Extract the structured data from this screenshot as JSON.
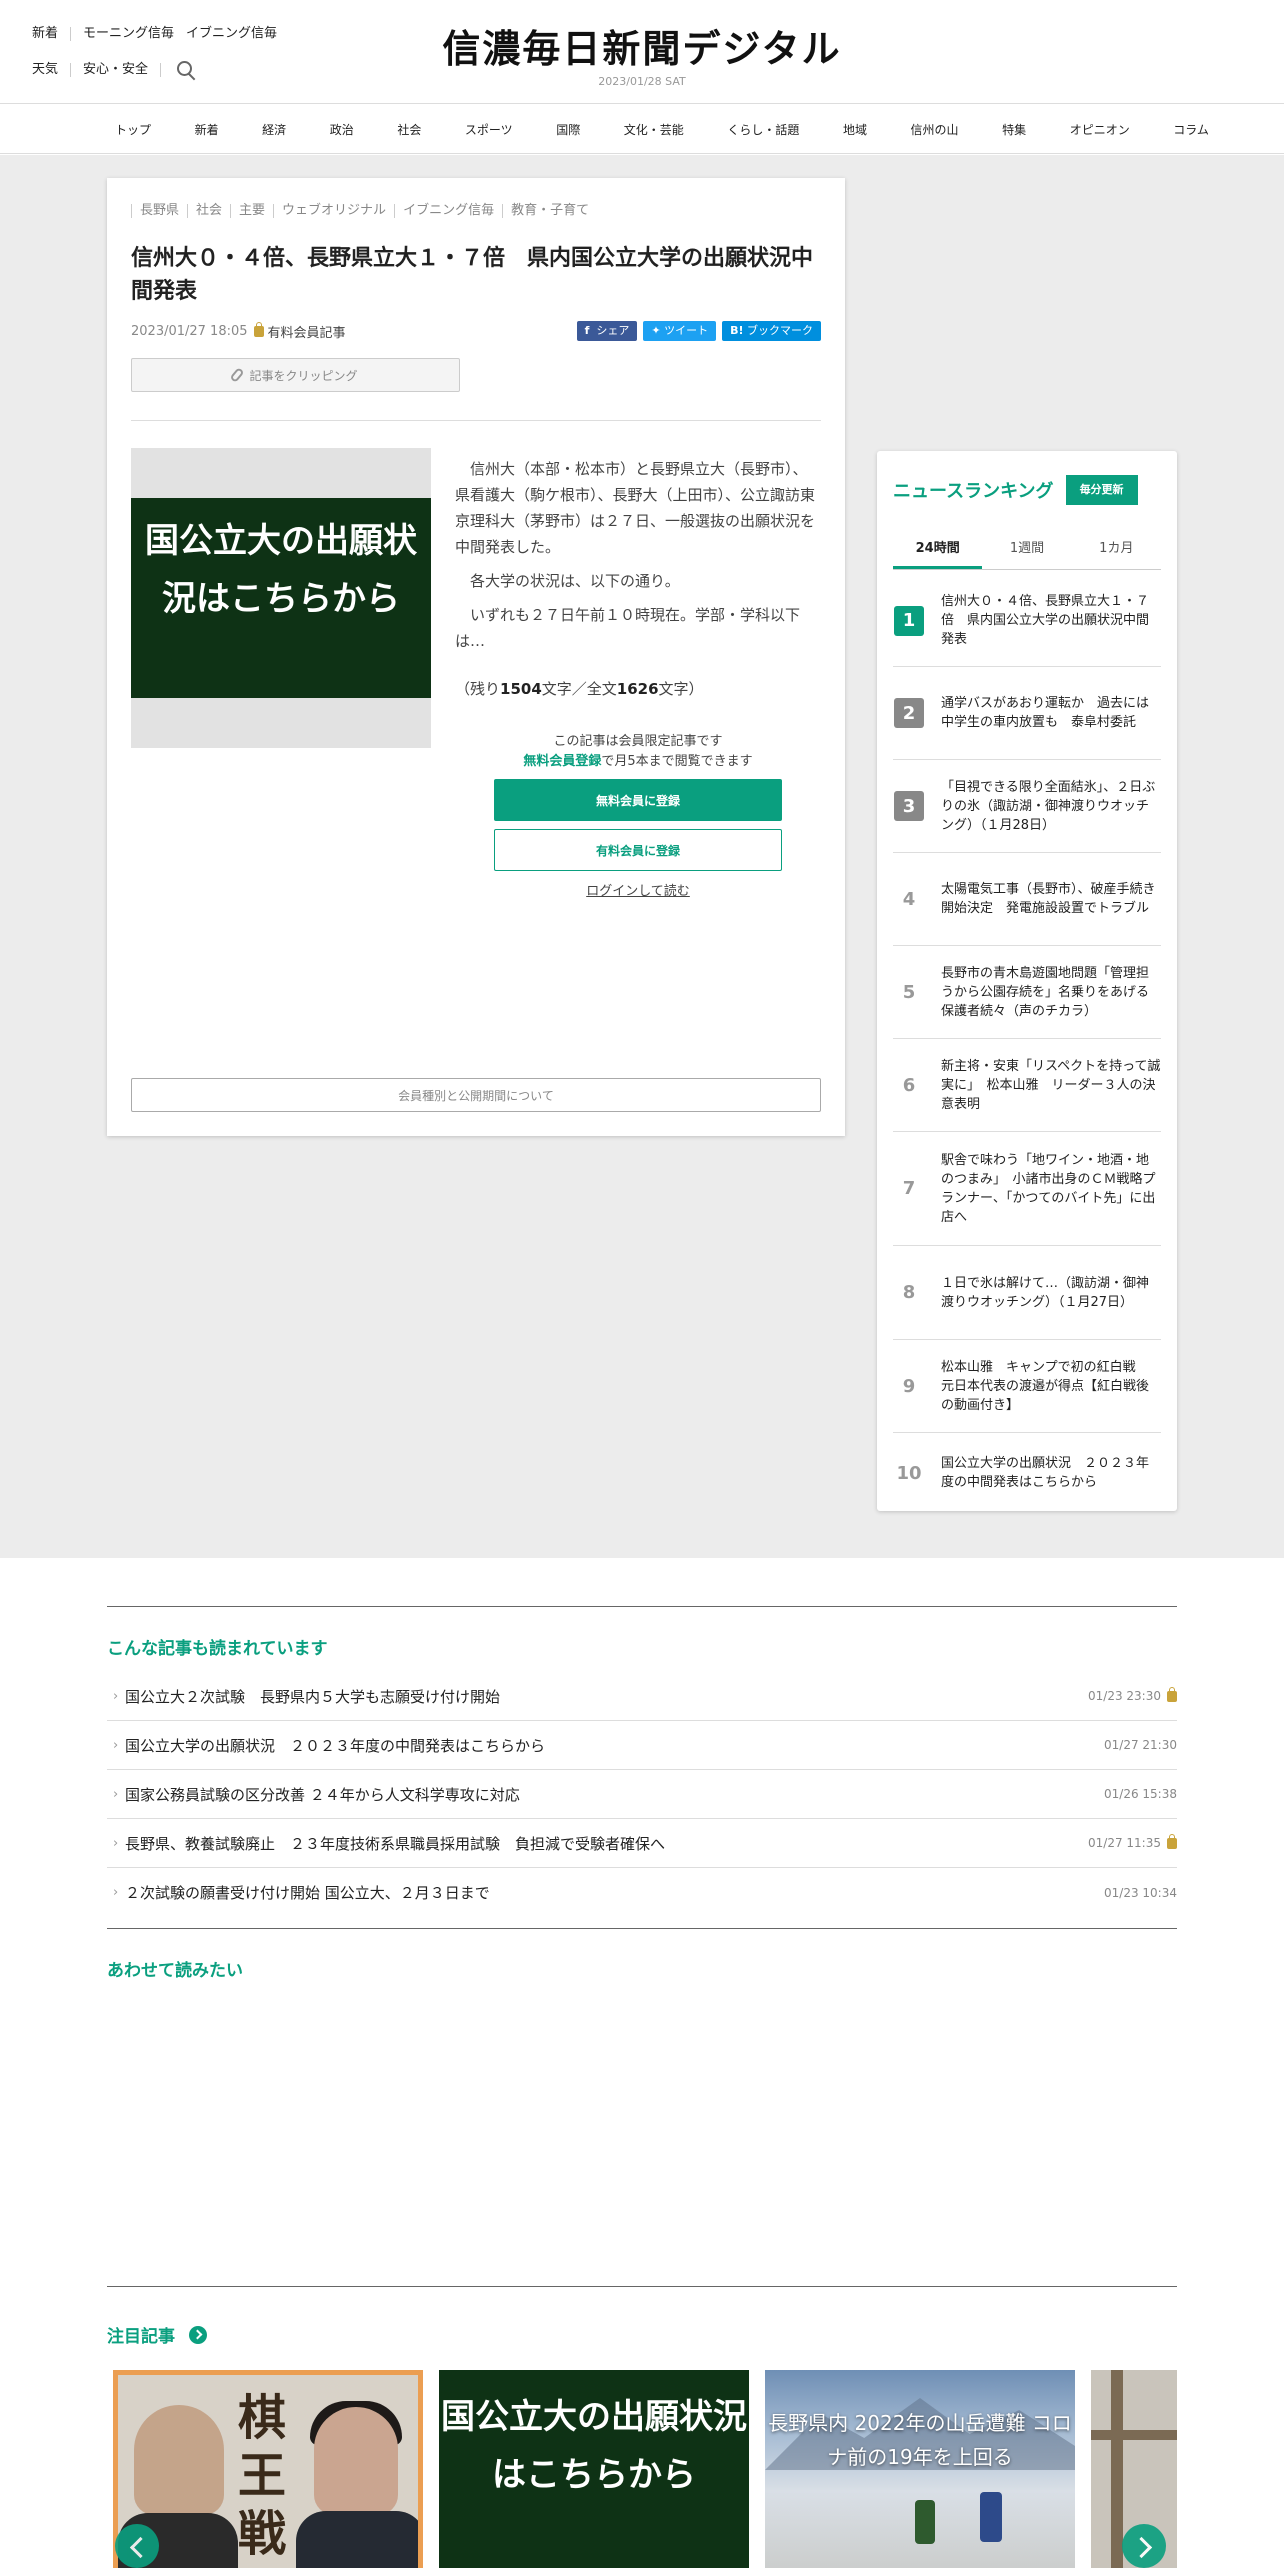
{
  "header": {
    "links_row1": [
      "新着",
      "モーニング信毎",
      "イブニング信毎"
    ],
    "links_row2": [
      "天気",
      "安心・安全"
    ],
    "logo": "信濃毎日新聞デジタル",
    "date": "2023/01/28 SAT"
  },
  "nav": [
    "トップ",
    "新着",
    "経済",
    "政治",
    "社会",
    "スポーツ",
    "国際",
    "文化・芸能",
    "くらし・話題",
    "地域",
    "信州の山",
    "特集",
    "オピニオン",
    "コラム"
  ],
  "article": {
    "tags": [
      "長野県",
      "社会",
      "主要",
      "ウェブオリジナル",
      "イブニング信毎",
      "教育・子育て"
    ],
    "headline": "信州大０・４倍、長野県立大１・７倍　県内国公立大学の出願状況中間発表",
    "datetime": "2023/01/27 18:05",
    "paid_label": "有料会員記事",
    "share_fb": "シェア",
    "share_tw": "ツイート",
    "share_hb": "ブックマーク",
    "clip_label": "記事をクリッピング",
    "thumb_text": "国公立大の出願状況はこちらから",
    "paragraphs": [
      "信州大（本部・松本市）と長野県立大（長野市）、県看護大（駒ケ根市）、長野大（上田市）、公立諏訪東京理科大（茅野市）は２７日、一般選抜の出願状況を中間発表した。",
      "各大学の状況は、以下の通り。",
      "いずれも２７日午前１０時現在。学部・学科以下は…"
    ],
    "remain_pre": "（残り",
    "remain_chars": "1504",
    "remain_mid": "文字／全文",
    "total_chars": "1626",
    "remain_post": "文字）",
    "members_line1": "この記事は会員限定記事です",
    "members_link": "無料会員登録",
    "members_line2": "で月5本まで閲覧できます",
    "btn_free": "無料会員に登録",
    "btn_paid": "有料会員に登録",
    "login": "ログインして読む",
    "plans": "会員種別と公開期間について"
  },
  "ranking": {
    "title": "ニュースランキング",
    "badge": "毎分更新",
    "tabs": [
      "24時間",
      "1週間",
      "1カ月"
    ],
    "items": [
      {
        "num": "1",
        "text": "信州大０・４倍、長野県立大１・７倍　県内国公立大学の出願状況中間発表"
      },
      {
        "num": "2",
        "text": "通学バスがあおり運転か　過去には中学生の車内放置も　泰阜村委託"
      },
      {
        "num": "3",
        "text": "「目視できる限り全面結氷」、２日ぶりの氷（諏訪湖・御神渡りウオッチング）（１月28日）"
      },
      {
        "num": "4",
        "text": "太陽電気工事（長野市）、破産手続き開始決定　発電施設設置でトラブル"
      },
      {
        "num": "5",
        "text": "長野市の青木島遊園地問題「管理担うから公園存続を」名乗りをあげる保護者続々（声のチカラ）"
      },
      {
        "num": "6",
        "text": "新主将・安東「リスペクトを持って誠実に」　松本山雅　リーダー３人の決意表明"
      },
      {
        "num": "7",
        "text": "駅舎で味わう「地ワイン・地酒・地のつまみ」　小諸市出身のＣＭ戦略プランナー、「かつてのバイト先」に出店へ"
      },
      {
        "num": "8",
        "text": "１日で氷は解けて…（諏訪湖・御神渡りウオッチング）（１月27日）"
      },
      {
        "num": "9",
        "text": "松本山雅　キャンプで初の紅白戦　元日本代表の渡邉が得点【紅白戦後の動画付き】"
      },
      {
        "num": "10",
        "text": "国公立大学の出願状況　２０２３年度の中間発表はこちらから"
      }
    ]
  },
  "also_read": {
    "title": "こんな記事も読まれています",
    "items": [
      {
        "title": "国公立大２次試験　長野県内５大学も志願受け付け開始",
        "date": "01/23 23:30",
        "locked": true
      },
      {
        "title": "国公立大学の出願状況　２０２３年度の中間発表はこちらから",
        "date": "01/27 21:30",
        "locked": false
      },
      {
        "title": "国家公務員試験の区分改善 ２４年から人文科学専攻に対応",
        "date": "01/26 15:38",
        "locked": false
      },
      {
        "title": "長野県、教養試験廃止　２３年度技術系県職員採用試験　負担減で受験者確保へ",
        "date": "01/27 11:35",
        "locked": true
      },
      {
        "title": "２次試験の願書受け付け開始 国公立大、２月３日まで",
        "date": "01/23 10:34",
        "locked": false
      }
    ]
  },
  "together": {
    "title": "あわせて読みたい"
  },
  "featured": {
    "title": "注目記事",
    "card1_kanji": "棋王戦",
    "card2_text": "国公立大の出願状況はこちらから",
    "card3_text": "長野県内 2022年の山岳遭難 コロナ前の19年を上回る"
  },
  "colors": {
    "accent": "#0a9f7f",
    "rank_top": "#0a9f7f",
    "rank_mid": "#888888",
    "dark_green": "#0e3215"
  }
}
